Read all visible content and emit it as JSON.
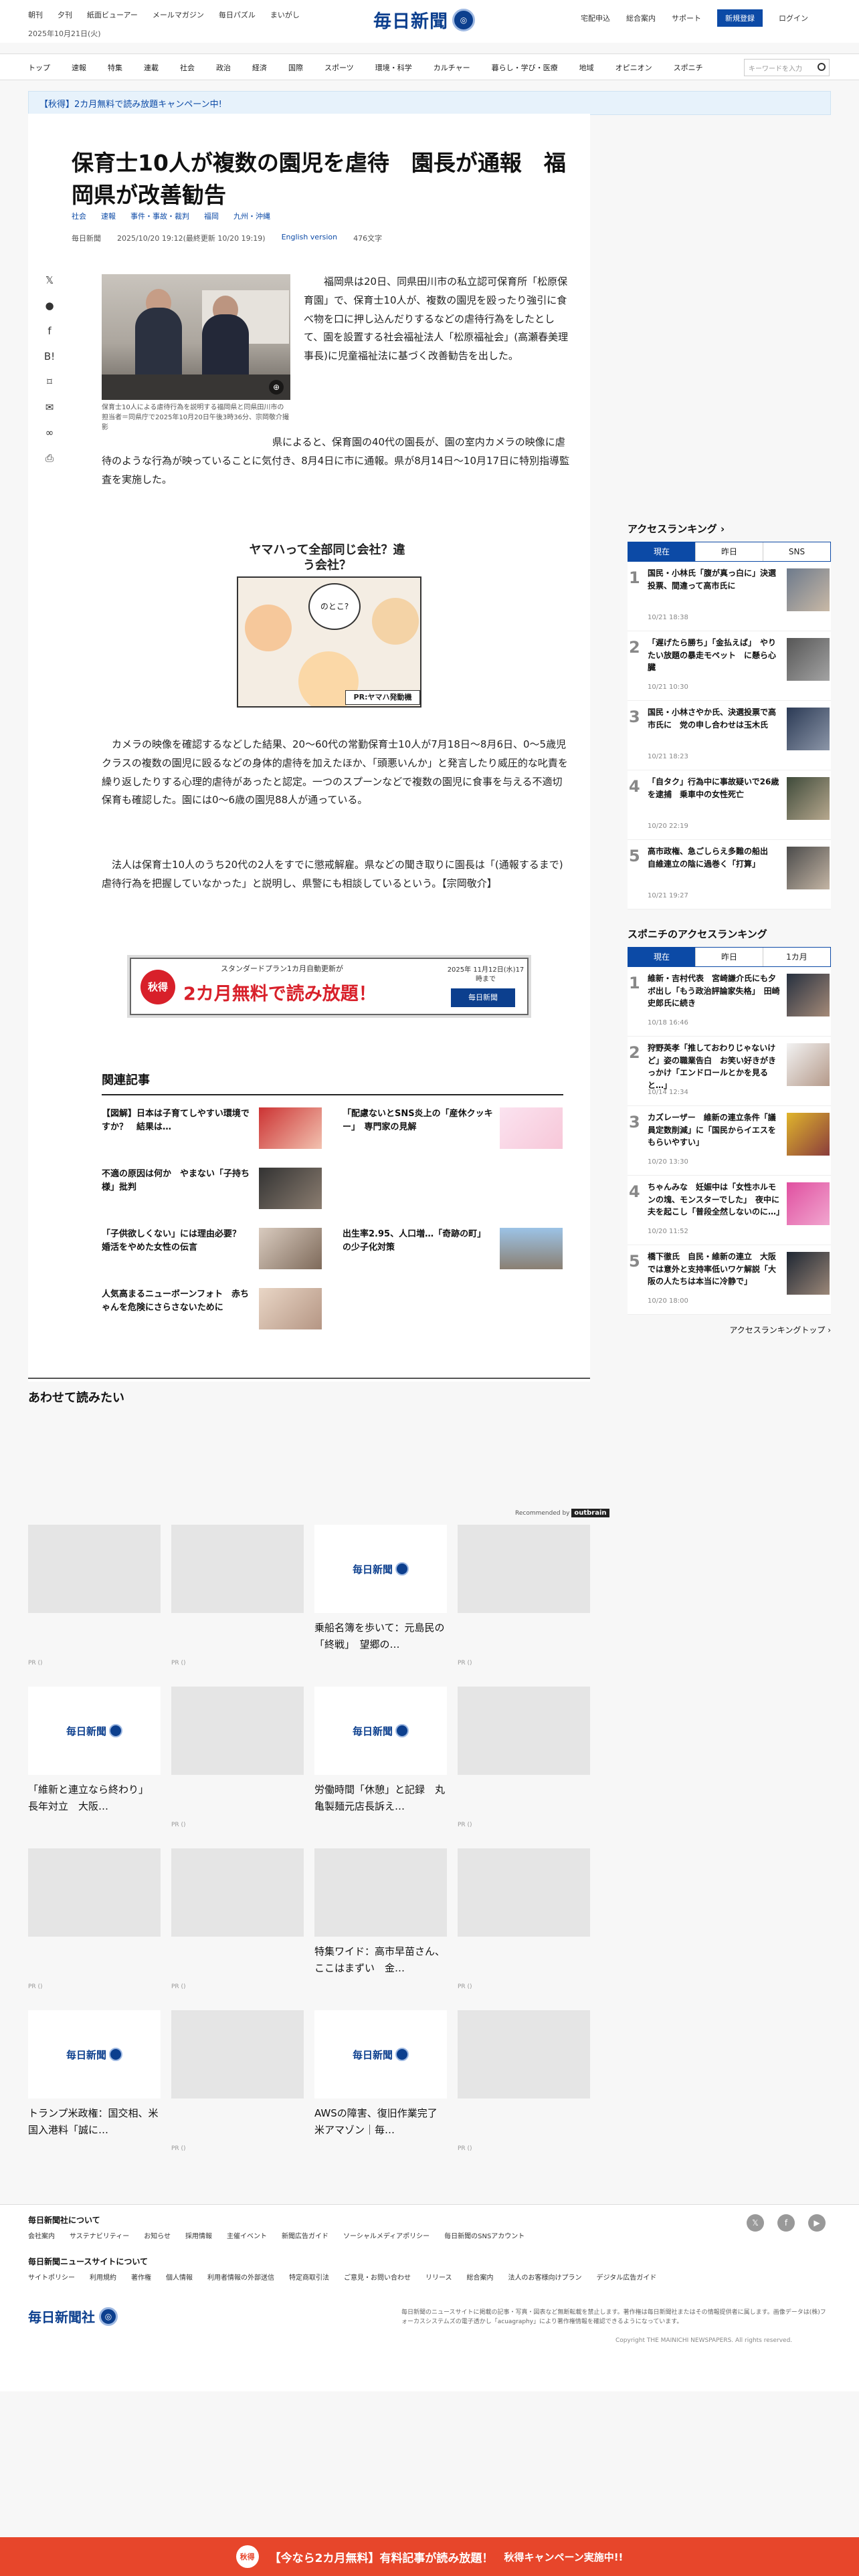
{
  "header": {
    "left_links": [
      "朝刊",
      "夕刊",
      "紙面ビューアー",
      "メールマガジン",
      "毎日パズル",
      "まいがし"
    ],
    "date": "2025年10月21日(火)",
    "logo": "毎日新聞",
    "right_links": [
      "宅配申込",
      "総合案内",
      "サポート"
    ],
    "register": "新規登録",
    "login": "ログイン"
  },
  "nav": {
    "items": [
      "トップ",
      "速報",
      "特集",
      "連載",
      "社会",
      "政治",
      "経済",
      "国際",
      "スポーツ",
      "環境・科学",
      "カルチャー",
      "暮らし・学び・医療",
      "地域",
      "オピニオン",
      "スポニチ"
    ],
    "search_placeholder": "キーワードを入力"
  },
  "campaign_bar": "【秋得】2カ月無料で読み放題キャンペーン中!",
  "article": {
    "title": "保育士10人が複数の園児を虐待　園長が通報　福岡県が改善勧告",
    "tags": [
      "社会",
      "速報",
      "事件・事故・裁判",
      "福岡",
      "九州・沖縄"
    ],
    "source": "毎日新聞",
    "datetime": "2025/10/20 19:12(最終更新 10/20 19:19)",
    "english": "English version",
    "chars": "476文字",
    "photo_caption": "保育士10人による虐待行為を説明する福岡県と同県田川市の担当者＝同県庁で2025年10月20日午後3時36分、宗岡敬介撮影",
    "paragraphs": [
      "福岡県は20日、同県田川市の私立認可保育所「松原保育園」で、保育士10人が、複数の園児を殴ったり強引に食べ物を口に押し込んだりするなどの虐待行為をしたとして、園を設置する社会福祉法人「松原福祉会」(高瀬春美理事長)に児童福祉法に基づく改善勧告を出した。",
      "県によると、保育園の40代の園長が、園の室内カメラの映像に虐待のような行為が映っていることに気付き、8月4日に市に通報。県が8月14日～10月17日に特別指導監査を実施した。",
      "カメラの映像を確認するなどした結果、20～60代の常勤保育士10人が7月18日～8月6日、0～5歳児クラスの複数の園児に殴るなどの身体的虐待を加えたほか、「頭悪いんか」と発言したり威圧的な叱責を繰り返したりする心理的虐待があったと認定。一つのスプーンなどで複数の園児に食事を与える不適切保育も確認した。園には0～6歳の園児88人が通っている。",
      "法人は保育士10人のうち20代の2人をすでに懲戒解雇。県などの聞き取りに園長は「(通報するまで)虐待行為を把握していなかった」と説明し、県警にも相談しているという。【宗岡敬介】"
    ]
  },
  "ad1": {
    "title": "ヤマハって全部同じ会社？違う会社？",
    "bubble": "のとこ?",
    "pr": "PR:ヤマハ発動機"
  },
  "ad2": {
    "badge": "秋得",
    "top": "スタンダードプラン1カ月自動更新が",
    "main": "2カ月無料で読み放題！",
    "date": "2025年 11月12日(水)17時まで",
    "logo": "毎日新聞"
  },
  "related": {
    "heading": "関連記事",
    "items": [
      {
        "title": "【図解】日本は子育てしやすい環境ですか？　結果は…"
      },
      {
        "title": "「配慮ないとSNS炎上の「産休クッキー」　専門家の見解"
      },
      {
        "title": "不適の原因は何か　やまない「子持ち様」批判"
      },
      {
        "title": "「子供欲しくない」には理由必要？　婚活をやめた女性の伝言"
      },
      {
        "title": "出生率2.95、人口増…「奇跡の町」の少子化対策"
      },
      {
        "title": "人気高まるニューボーンフォト　赤ちゃんを危険にさらさないために"
      }
    ]
  },
  "sidebar": {
    "ranking_title": "アクセスランキング",
    "tabs": [
      "現在",
      "昨日",
      "SNS"
    ],
    "items": [
      {
        "n": "1",
        "title": "国民・小林氏「腹が真っ白に」決選投票、間違って高市氏に",
        "date": "10/21 18:38"
      },
      {
        "n": "2",
        "title": "「遅げたら勝ち」「金払えば」　やりたい放題の暴走モペット　に懸ら心臓",
        "date": "10/21 10:30"
      },
      {
        "n": "3",
        "title": "国民・小林さやか氏、決選投票で高市氏に　党の申し合わせは玉木氏",
        "date": "10/21 18:23"
      },
      {
        "n": "4",
        "title": "「自タク」行為中に事故疑いで26歳を逮捕　乗車中の女性死亡",
        "date": "10/20 22:19"
      },
      {
        "n": "5",
        "title": "高市政権、急ごしらえ多難の船出　自維連立の陰に過巻く「打算」",
        "date": "10/21 19:27"
      }
    ],
    "sponichi_title": "スポニチのアクセスランキング",
    "sponichi_tabs": [
      "現在",
      "昨日",
      "1カ月"
    ],
    "sponichi_items": [
      {
        "n": "1",
        "title": "維新・吉村代表　宮崎謙介氏にも夕ボ出し「もう政治評論家失格」　田崎史郎氏に続き",
        "date": "10/18 16:46"
      },
      {
        "n": "2",
        "title": "狩野英孝「推しておわりじゃないけど」姿の職業告白　お笑い好きがきっかけ「エンドロールとかを見ると…」",
        "date": "10/14 12:34"
      },
      {
        "n": "3",
        "title": "カズレーザー　維新の連立条件「議員定数削減」に「国民からイエスをもらいやすい」",
        "date": "10/20 13:30"
      },
      {
        "n": "4",
        "title": "ちゃんみな　妊娠中は「女性ホルモンの塊、モンスターでした」　夜中に夫を起こし「普段全然しないのに…」",
        "date": "10/20 11:52"
      },
      {
        "n": "5",
        "title": "橋下徹氏　自民・維新の連立　大阪では意外と支持率低いワケ解説「大阪の人たちは本当に冷静で」",
        "date": "10/20 18:00"
      }
    ],
    "more": "アクセスランキングトップ"
  },
  "awasete": {
    "title": "あわせて読みたい",
    "recommended": "Recommended by",
    "recommended_brand": "outbrain",
    "cards": [
      {
        "title": "",
        "pr": "PR ()"
      },
      {
        "title": "",
        "pr": "PR ()"
      },
      {
        "title": "乗船名簿を歩いて：元島民の「終戦」　望郷の…",
        "pr": ""
      },
      {
        "title": "",
        "pr": "PR ()"
      },
      {
        "title": "「維新と連立なら終わり」　長年対立　大阪…",
        "pr": ""
      },
      {
        "title": "",
        "pr": "PR ()"
      },
      {
        "title": "労働時間「休憩」と記録　丸亀製麺元店長訴え…",
        "pr": ""
      },
      {
        "title": "",
        "pr": "PR ()"
      },
      {
        "title": "",
        "pr": "PR ()"
      },
      {
        "title": "",
        "pr": "PR ()"
      },
      {
        "title": "特集ワイド：高市早苗さん、ここはまずい　金…",
        "pr": ""
      },
      {
        "title": "",
        "pr": "PR ()"
      },
      {
        "title": "トランプ米政権：国交相、米国入港料「誠に…",
        "pr": ""
      },
      {
        "title": "",
        "pr": "PR ()"
      },
      {
        "title": "AWSの障害、復旧作業完了　米アマゾン｜毎…",
        "pr": ""
      },
      {
        "title": "",
        "pr": "PR ()"
      }
    ]
  },
  "footer": {
    "about_title": "毎日新聞社について",
    "about_links": [
      "会社案内",
      "サステナビリティー",
      "お知らせ",
      "採用情報",
      "主催イベント",
      "新聞広告ガイド",
      "ソーシャルメディアポリシー",
      "毎日新聞のSNSアカウント"
    ],
    "site_title": "毎日新聞ニュースサイトについて",
    "site_links": [
      "サイトポリシー",
      "利用規約",
      "著作権",
      "個人情報",
      "利用者情報の外部送信",
      "特定商取引法",
      "ご意見・お問い合わせ",
      "リリース",
      "総合案内",
      "法人のお客様向けプラン",
      "デジタル広告ガイド"
    ],
    "logo": "毎日新聞社",
    "note": "毎日新聞のニュースサイトに掲載の記事・写真・図表など無断転載を禁止します。著作権は毎日新聞社またはその情報提供者に属します。画像データは(株)フォーカスシステムズの電子透かし「acuagraphy」により著作権情報を確認できるようになっています。",
    "copyright": "Copyright THE MAINICHI NEWSPAPERS. All rights reserved."
  },
  "bottom_banner": {
    "badge": "秋得",
    "text": "【今なら2カ月無料】有料記事が読み放題！",
    "sub": "秋得キャンペーン実施中!!"
  }
}
